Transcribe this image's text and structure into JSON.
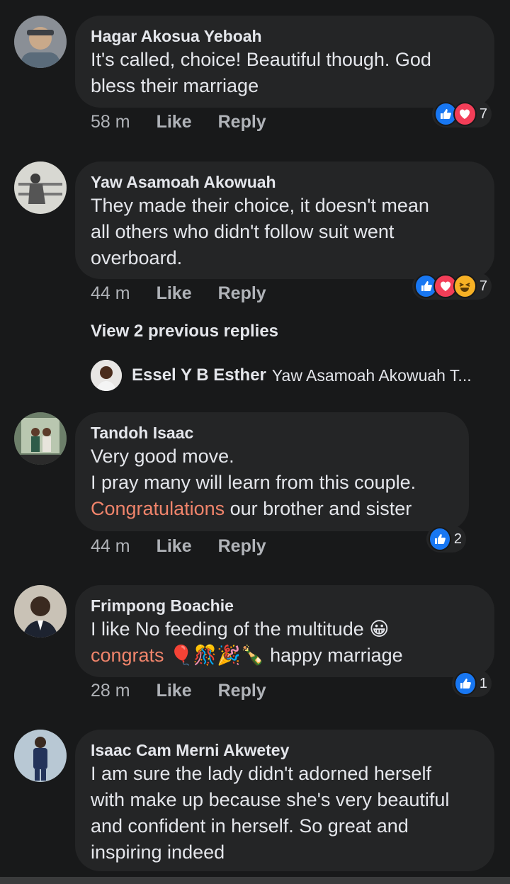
{
  "comments": [
    {
      "author": "Hagar Akosua Yeboah",
      "lines": [
        "It's called, choice! Beautiful though. God",
        "bless their marriage"
      ],
      "time": "58 m",
      "like": "Like",
      "reply": "Reply",
      "reactions": [
        "like-icon",
        "love-icon"
      ],
      "react_count": "7"
    },
    {
      "author": "Yaw Asamoah Akowuah",
      "lines": [
        "They made their choice, it doesn't mean",
        "all others who didn't follow suit went",
        "overboard."
      ],
      "time": "44 m",
      "like": "Like",
      "reply": "Reply",
      "reactions": [
        "like-icon",
        "love-icon",
        "haha-icon"
      ],
      "react_count": "7"
    },
    {
      "author": "Tandoh Isaac",
      "lines": [
        "Very good move.",
        "I pray many will learn from this couple."
      ],
      "highlight": "Congratulations",
      "line_after_highlight": " our brother and sister",
      "time": "44 m",
      "like": "Like",
      "reply": "Reply",
      "reactions": [
        "like-icon"
      ],
      "react_count": "2"
    },
    {
      "author": "Frimpong Boachie",
      "line1": "I like No feeding of the multitude 😀",
      "highlight": "congrats",
      "emojis": "🎈🎊🎉🍾",
      "line2_rest": " happy marriage",
      "time": "28 m",
      "like": "Like",
      "reply": "Reply",
      "reactions": [
        "like-icon"
      ],
      "react_count": "1"
    },
    {
      "author": "Isaac Cam Merni Akwetey",
      "lines": [
        "I am sure the lady didn't adorned herself",
        "with make up because she's very beautiful",
        "and confident in herself. So great and",
        "inspiring indeed"
      ]
    }
  ],
  "view_previous": "View 2 previous replies",
  "latest_reply": {
    "author": "Essel Y B Esther",
    "preview": "Yaw Asamoah Akowuah T..."
  },
  "colors": {
    "background": "#18191a",
    "bubble": "#242526",
    "highlight": "#f0846b",
    "like": "#1877f2",
    "love": "#f33e58",
    "haha": "#f7b125"
  }
}
